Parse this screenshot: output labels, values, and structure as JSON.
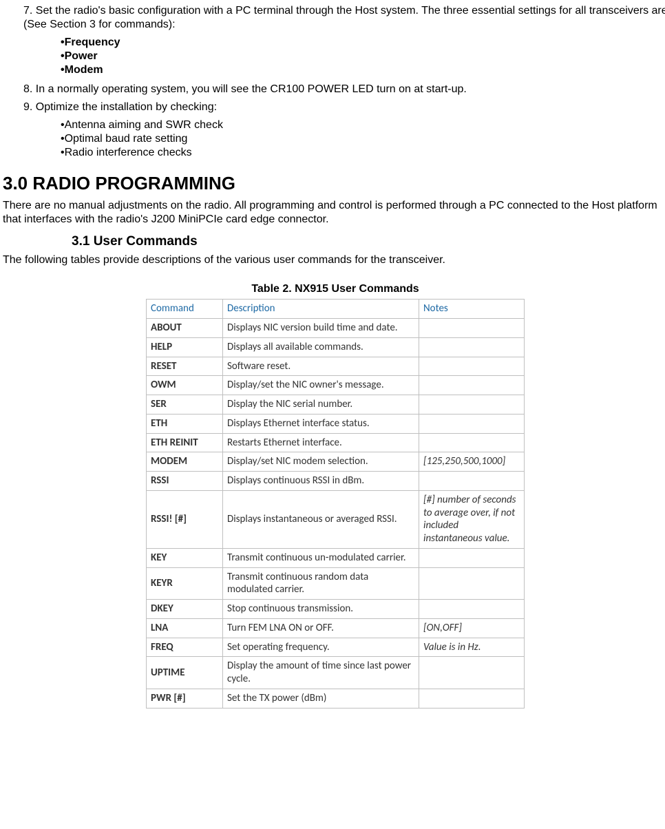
{
  "steps": {
    "s7": "7. Set the radio's basic configuration with a PC terminal through the Host system. The three essential settings for all transceivers are (See Section 3 for commands):",
    "s7_bullets": [
      "Frequency",
      "Power",
      "Modem"
    ],
    "s8": "8. In a normally operating system, you will see the CR100 POWER LED turn on at start-up.",
    "s9": "9. Optimize the installation by checking:",
    "s9_bullets": [
      "Antenna aiming and SWR check",
      "Optimal baud rate setting",
      "Radio interference checks"
    ]
  },
  "section3": {
    "heading": "3.0 RADIO PROGRAMMING",
    "para": "There are no manual adjustments on the radio. All programming and control is performed through a PC connected to the Host platform that interfaces with the radio's J200 MiniPCIe card edge connector.",
    "sub_heading": "3.1 User Commands",
    "sub_para": "The following tables provide descriptions of the various user commands for the transceiver."
  },
  "table": {
    "caption": "Table 2. NX915 User Commands",
    "headers": [
      "Command",
      "Description",
      "Notes"
    ],
    "rows": [
      {
        "cmd": "ABOUT",
        "desc": "Displays NIC version build time and date.",
        "notes": ""
      },
      {
        "cmd": "HELP",
        "desc": "Displays all available commands.",
        "notes": ""
      },
      {
        "cmd": "RESET",
        "desc": "Software reset.",
        "notes": ""
      },
      {
        "cmd": "OWM",
        "desc": "Display/set the NIC owner's message.",
        "notes": ""
      },
      {
        "cmd": "SER",
        "desc": "Display the NIC serial number.",
        "notes": ""
      },
      {
        "cmd": "ETH",
        "desc": "Displays Ethernet interface status.",
        "notes": ""
      },
      {
        "cmd": "ETH REINIT",
        "desc": "Restarts Ethernet interface.",
        "notes": ""
      },
      {
        "cmd": "MODEM",
        "desc": "Display/set NIC modem selection.",
        "notes": "[125,250,500,1000]"
      },
      {
        "cmd": "RSSI",
        "desc": "Displays continuous RSSI in dBm.",
        "notes": ""
      },
      {
        "cmd": "RSSI! [#]",
        "desc": "Displays instantaneous or averaged RSSI.",
        "notes": "[#] number of seconds to average over, if not included instantaneous value."
      },
      {
        "cmd": "KEY",
        "desc": "Transmit continuous un-modulated carrier.",
        "notes": ""
      },
      {
        "cmd": "KEYR",
        "desc": "Transmit continuous random data modulated carrier.",
        "notes": ""
      },
      {
        "cmd": "DKEY",
        "desc": "Stop continuous transmission.",
        "notes": ""
      },
      {
        "cmd": "LNA",
        "desc": "Turn FEM LNA ON or OFF.",
        "notes": "[ON,OFF]"
      },
      {
        "cmd": "FREQ",
        "desc": "Set operating frequency.",
        "notes": "Value is in Hz."
      },
      {
        "cmd": "UPTIME",
        "desc": "Display the amount of time since last power cycle.",
        "notes": ""
      },
      {
        "cmd": "PWR [#]",
        "desc": "Set the TX power (dBm)",
        "notes": ""
      }
    ]
  }
}
